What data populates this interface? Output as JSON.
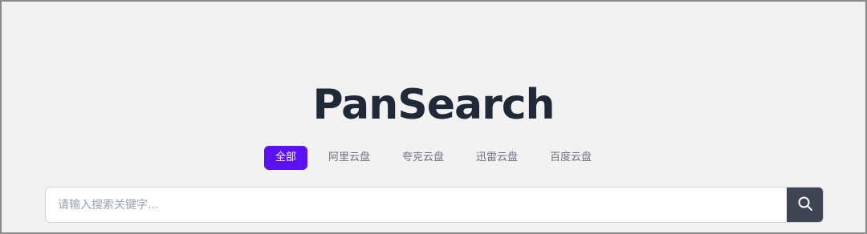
{
  "logo": {
    "text": "PanSearch"
  },
  "tabs": [
    {
      "label": "全部",
      "active": true
    },
    {
      "label": "阿里云盘",
      "active": false
    },
    {
      "label": "夸克云盘",
      "active": false
    },
    {
      "label": "迅雷云盘",
      "active": false
    },
    {
      "label": "百度云盘",
      "active": false
    }
  ],
  "search": {
    "placeholder": "请输入搜索关键字...",
    "value": "",
    "button_icon": "search-icon"
  },
  "colors": {
    "background": "#f2f2f2",
    "accent": "#5b12f3",
    "logo_text": "#1f2937",
    "search_button": "#3d4452"
  }
}
